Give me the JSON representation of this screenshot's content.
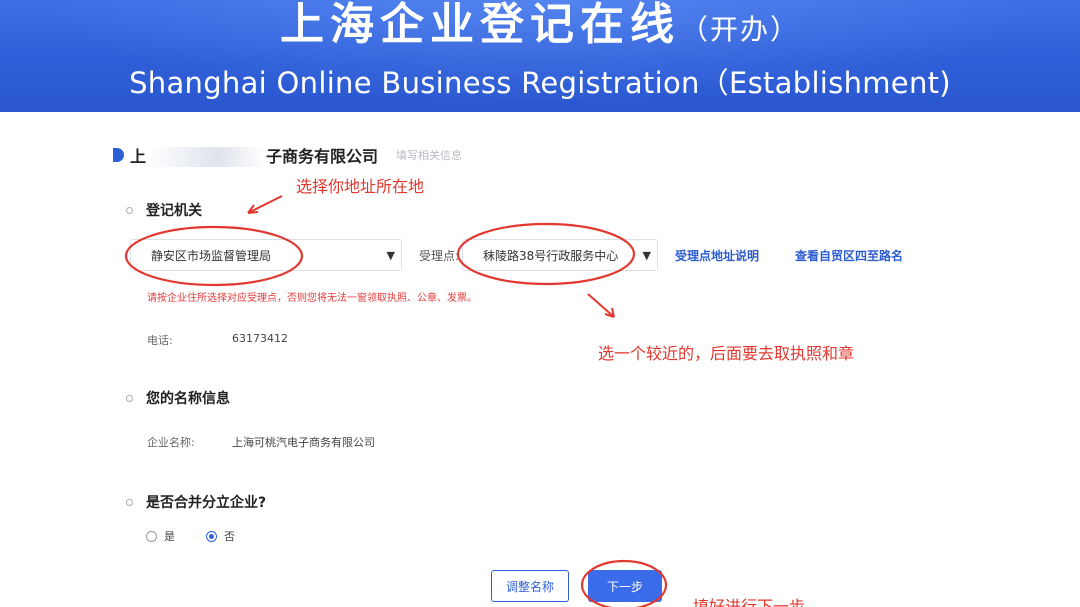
{
  "banner": {
    "title": "上海企业登记在线",
    "title_suffix": "（开办）",
    "subtitle_en": "Shanghai Online Business Registration（Establishment)"
  },
  "company": {
    "name_prefix": "上",
    "name_suffix": "子商务有限公司",
    "hint": "填写相关信息"
  },
  "registration": {
    "section_title": "登记机关",
    "authority_value": "静安区市场监督管理局",
    "acceptance_label": "受理点:",
    "acceptance_value": "秣陵路38号行政服务中心",
    "address_link": "受理点地址说明",
    "boundary_link": "查看自贸区四至路名",
    "warning": "请按企业住所选择对应受理点，否则您将无法一窗领取执照、公章、发票。",
    "phone_label": "电话:",
    "phone_value": "63173412"
  },
  "name_info": {
    "section_title": "您的名称信息",
    "company_label": "企业名称:",
    "company_value": "上海可桃汽电子商务有限公司"
  },
  "merge": {
    "section_title": "是否合并分立企业?",
    "option_yes": "是",
    "option_no": "否",
    "selected": "否"
  },
  "buttons": {
    "adjust_name": "调整名称",
    "next_step": "下一步"
  },
  "annotations": {
    "choose_location": "选择你地址所在地",
    "choose_nearby": "选一个较近的，后面要去取执照和章",
    "fill_next": "填好进行下一步"
  },
  "colors": {
    "banner_blue": "#2f5fd8",
    "annotation_red": "#e2382f",
    "link_blue": "#2d5ccf",
    "warning_red": "#e23c3c"
  }
}
